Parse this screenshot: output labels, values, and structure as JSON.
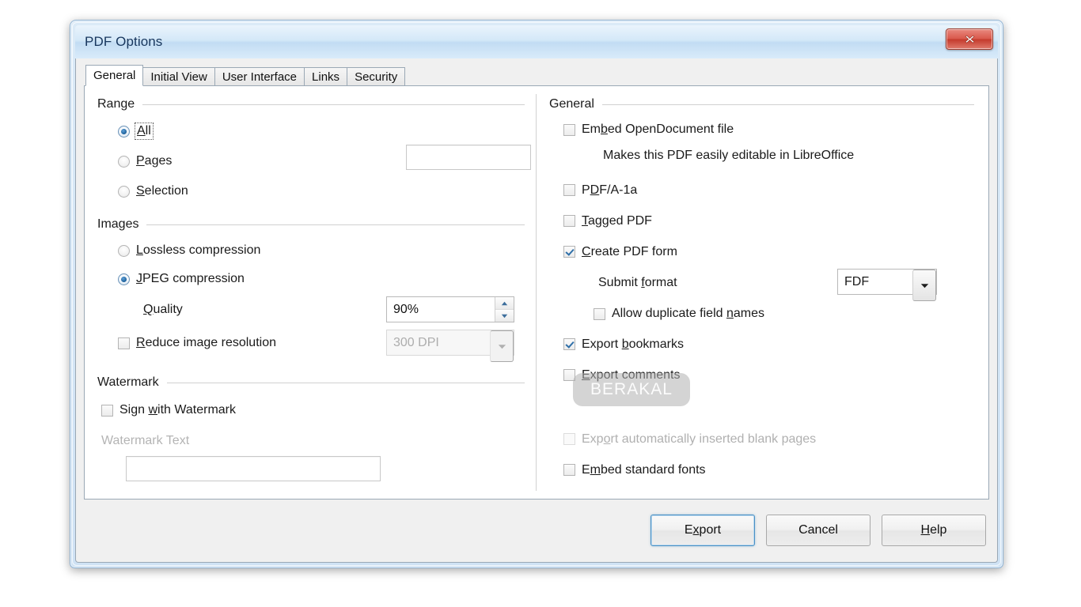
{
  "window": {
    "title": "PDF Options",
    "close_label": "x"
  },
  "tabs": [
    {
      "label": "General",
      "active": true
    },
    {
      "label": "Initial View",
      "active": false
    },
    {
      "label": "User Interface",
      "active": false
    },
    {
      "label": "Links",
      "active": false
    },
    {
      "label": "Security",
      "active": false
    }
  ],
  "left": {
    "range": {
      "title": "Range",
      "all": "All",
      "pages": "Pages",
      "selection": "Selection",
      "pages_value": "",
      "selected": "all"
    },
    "images": {
      "title": "Images",
      "lossless": "Lossless compression",
      "jpeg": "JPEG compression",
      "selected": "jpeg",
      "quality_label": "Quality",
      "quality_value": "90%",
      "reduce_label": "Reduce image resolution",
      "reduce_checked": false,
      "dpi_value": "300 DPI"
    },
    "watermark": {
      "title": "Watermark",
      "sign_label": "Sign with Watermark",
      "sign_checked": false,
      "text_label": "Watermark Text",
      "text_value": ""
    }
  },
  "right": {
    "title": "General",
    "embed_odf": "Embed OpenDocument file",
    "embed_odf_hint": "Makes this PDF easily editable in LibreOffice",
    "pdfa": "PDF/A-1a",
    "tagged": "Tagged PDF",
    "create_form": "Create PDF form",
    "submit_format_label": "Submit format",
    "submit_format_value": "FDF",
    "allow_duplicate": "Allow duplicate field names",
    "export_bookmarks": "Export bookmarks",
    "export_comments": "Export comments",
    "export_blank_pages": "Export automatically inserted blank pages",
    "embed_fonts": "Embed standard fonts"
  },
  "buttons": {
    "export": "Export",
    "cancel": "Cancel",
    "help": "Help"
  },
  "overlay": {
    "brand": "BERAKAL"
  },
  "colors": {
    "title_bar": "#d4e8f8",
    "close_button": "#c43a2c",
    "accent_check": "#2f6fa8",
    "default_button_border": "#4a90c4"
  }
}
